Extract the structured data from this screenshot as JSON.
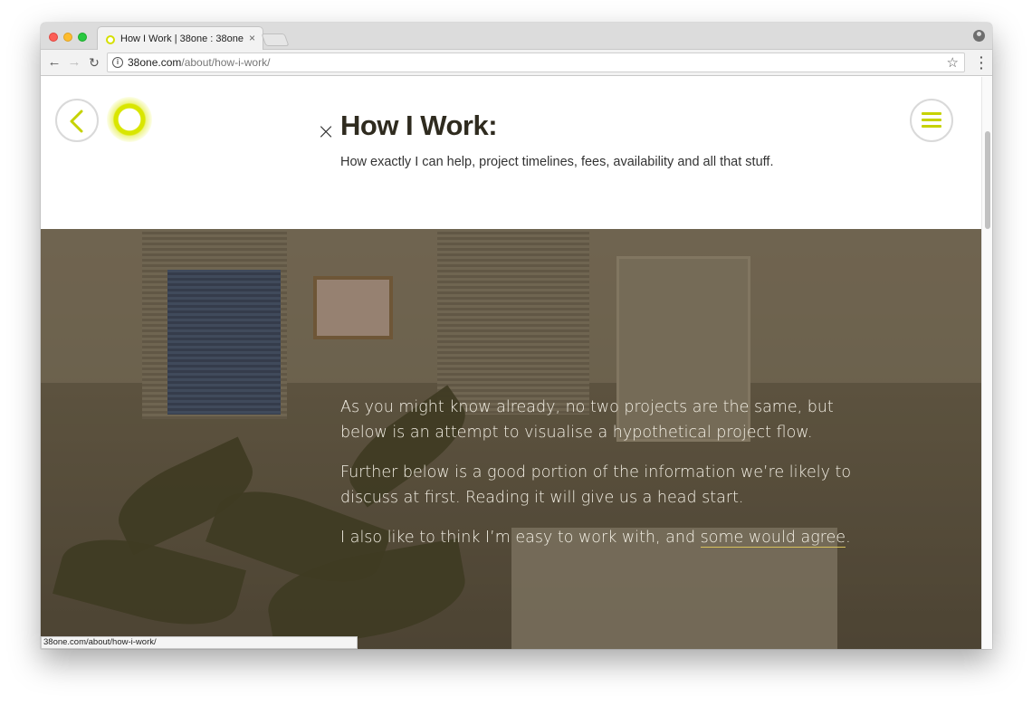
{
  "browser": {
    "tab_title": "How I Work | 38one : 38one",
    "tab_close": "×",
    "url_domain": "38one.com",
    "url_path": "/about/how-i-work/",
    "status_url": "38one.com/about/how-i-work/"
  },
  "header": {
    "title": "How I Work:",
    "subtitle": "How exactly I can help, project timelines, fees, availability and all that stuff.",
    "close_glyph": "×"
  },
  "hero": {
    "paragraphs": [
      "As you might know already, no two projects are the same, but below is an attempt to visualise a hypothetical project flow.",
      "Further below is a good portion of the information we’re likely to discuss at first. Reading it will give us a head start."
    ],
    "para3_prefix": "I also like to think I’m easy to work with, and ",
    "para3_link": "some would agree",
    "para3_suffix": "."
  },
  "colors": {
    "accent": "#d5e000",
    "title": "#2f2b1f",
    "link_underline": "#d9c25b"
  },
  "icons": {
    "back": "chevron-left-icon",
    "logo": "38one-logo-icon",
    "menu": "hamburger-menu-icon",
    "close": "close-icon"
  }
}
